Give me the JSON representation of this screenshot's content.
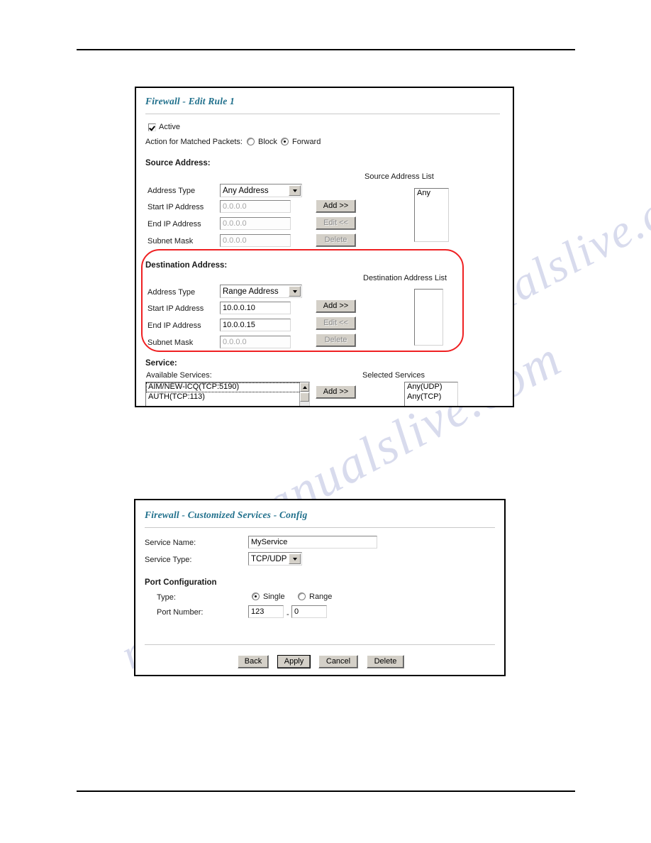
{
  "page": {
    "watermark_text": "manualslive.com"
  },
  "edit_rule_panel": {
    "title": "Firewall - Edit Rule 1",
    "active": {
      "label": "Active",
      "checked": true
    },
    "action": {
      "label": "Action for Matched Packets:",
      "options": [
        "Block",
        "Forward"
      ],
      "selected": "Forward"
    },
    "source": {
      "heading": "Source Address:",
      "list_title": "Source Address List",
      "rows": [
        {
          "label": "Address Type",
          "value": "Any Address",
          "type": "select"
        },
        {
          "label": "Start IP Address",
          "value": "0.0.0.0",
          "disabled": true
        },
        {
          "label": "End IP Address",
          "value": "0.0.0.0",
          "disabled": true
        },
        {
          "label": "Subnet Mask",
          "value": "0.0.0.0",
          "disabled": true
        }
      ],
      "buttons": [
        {
          "label": "Add >>",
          "enabled": true
        },
        {
          "label": "Edit <<",
          "enabled": false
        },
        {
          "label": "Delete",
          "enabled": false
        }
      ],
      "list_items": [
        "Any"
      ]
    },
    "destination": {
      "heading": "Destination Address:",
      "list_title": "Destination Address List",
      "rows": [
        {
          "label": "Address Type",
          "value": "Range Address",
          "type": "select"
        },
        {
          "label": "Start IP Address",
          "value": "10.0.0.10",
          "disabled": false
        },
        {
          "label": "End IP Address",
          "value": "10.0.0.15",
          "disabled": false
        },
        {
          "label": "Subnet Mask",
          "value": "0.0.0.0",
          "disabled": true
        }
      ],
      "buttons": [
        {
          "label": "Add >>",
          "enabled": true
        },
        {
          "label": "Edit <<",
          "enabled": false
        },
        {
          "label": "Delete",
          "enabled": false
        }
      ],
      "list_items": [],
      "annotation_color": "#ef2022"
    },
    "service": {
      "heading": "Service:",
      "available_label": "Available Services:",
      "available_items": [
        "AIM/NEW-ICQ(TCP:5190)",
        "AUTH(TCP:113)"
      ],
      "add_label": "Add >>",
      "selected_label": "Selected Services",
      "selected_items": [
        "Any(UDP)",
        "Any(TCP)"
      ]
    }
  },
  "cust_service_panel": {
    "title": "Firewall - Customized Services - Config",
    "service_name": {
      "label": "Service Name:",
      "value": "MyService"
    },
    "service_type": {
      "label": "Service Type:",
      "value": "TCP/UDP"
    },
    "port_config": {
      "heading": "Port Configuration",
      "type_label": "Type:",
      "type_options": [
        "Single",
        "Range"
      ],
      "type_selected": "Single",
      "port_label": "Port Number:",
      "port_start": "123",
      "port_separator": "-",
      "port_end": "0"
    },
    "buttons": [
      {
        "label": "Back",
        "default": false
      },
      {
        "label": "Apply",
        "default": true
      },
      {
        "label": "Cancel",
        "default": false
      },
      {
        "label": "Delete",
        "default": false
      }
    ]
  }
}
